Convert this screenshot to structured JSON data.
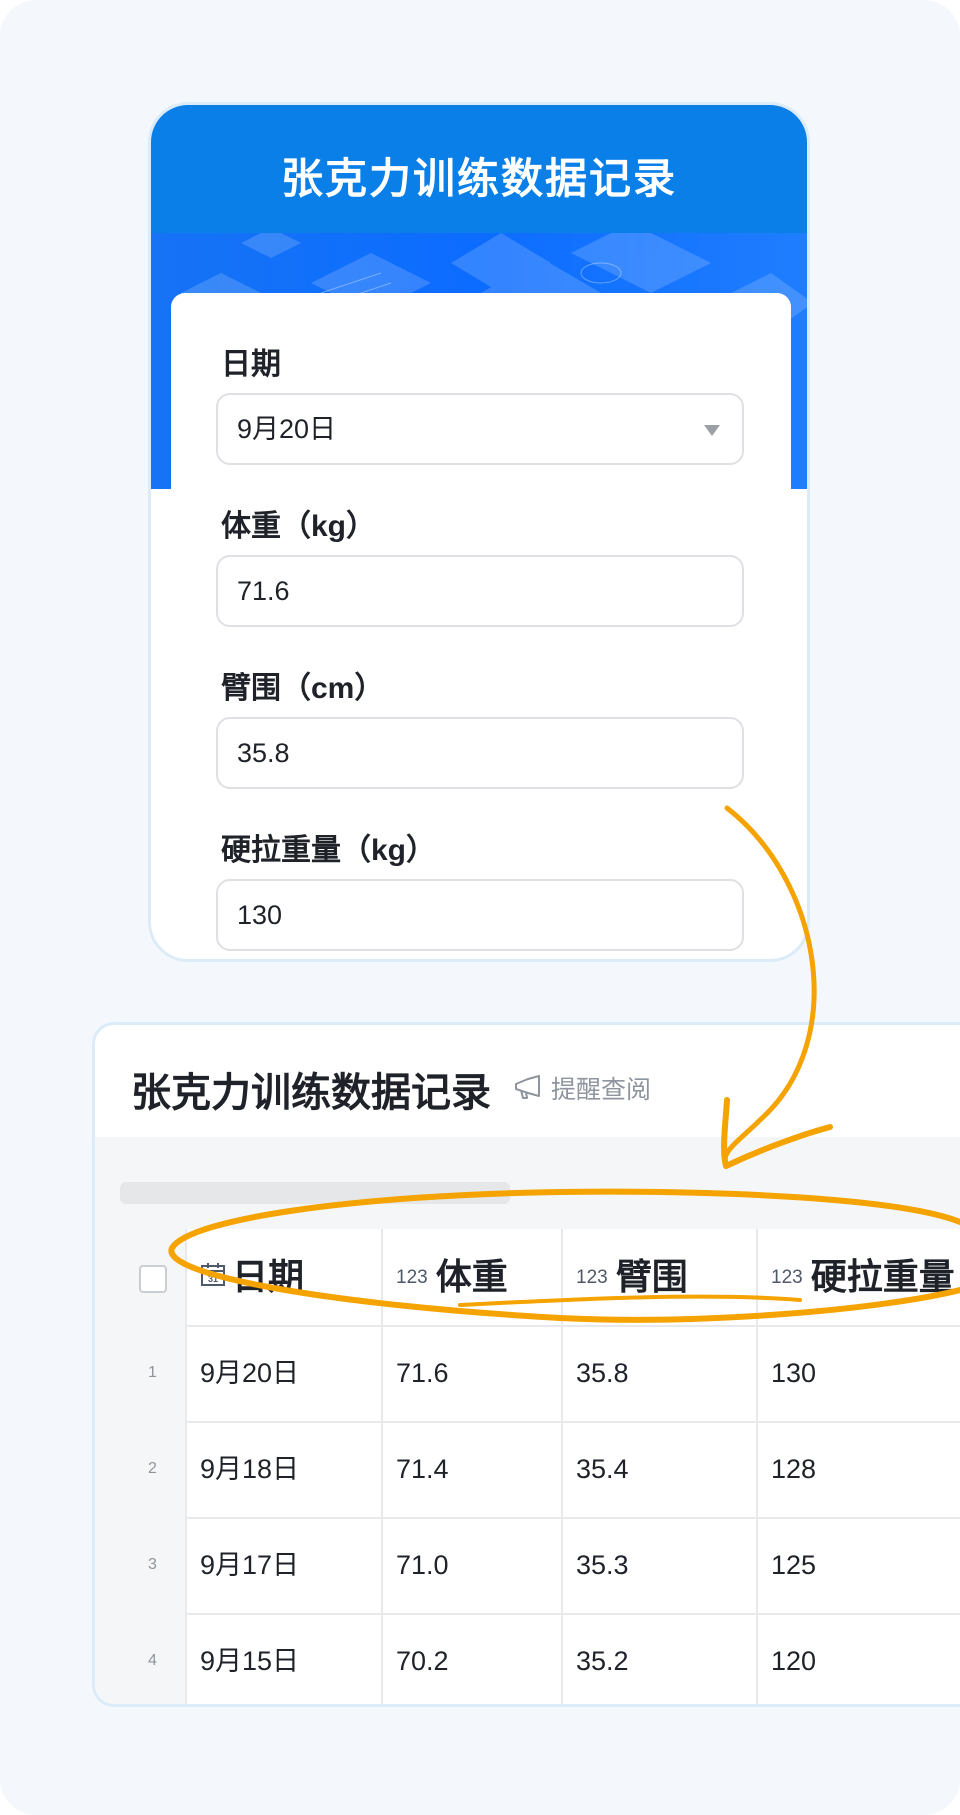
{
  "form": {
    "title": "张克力训练数据记录",
    "fields": [
      {
        "label": "日期",
        "value": "9月20日",
        "type": "select"
      },
      {
        "label": "体重（kg）",
        "value": "71.6",
        "type": "text"
      },
      {
        "label": "臂围（cm）",
        "value": "35.8",
        "type": "text"
      },
      {
        "label": "硬拉重量（kg）",
        "value": "130",
        "type": "text"
      }
    ]
  },
  "table": {
    "title": "张克力训练数据记录",
    "remind_label": "提醒查阅",
    "columns": [
      {
        "label": "日期",
        "icon": "calendar-icon",
        "icon_text": "31"
      },
      {
        "label": "体重",
        "icon": "number-icon",
        "icon_text": "123"
      },
      {
        "label": "臂围",
        "icon": "number-icon",
        "icon_text": "123"
      },
      {
        "label": "硬拉重量",
        "icon": "number-icon",
        "icon_text": "123"
      }
    ],
    "rows": [
      {
        "index": "1",
        "cells": [
          "9月20日",
          "71.6",
          "35.8",
          "130"
        ]
      },
      {
        "index": "2",
        "cells": [
          "9月18日",
          "71.4",
          "35.4",
          "128"
        ]
      },
      {
        "index": "3",
        "cells": [
          "9月17日",
          "71.0",
          "35.3",
          "125"
        ]
      },
      {
        "index": "4",
        "cells": [
          "9月15日",
          "70.2",
          "35.2",
          "120"
        ]
      }
    ]
  },
  "colors": {
    "brand_blue": "#0a7fe8",
    "annotation_orange": "#f5a300"
  }
}
